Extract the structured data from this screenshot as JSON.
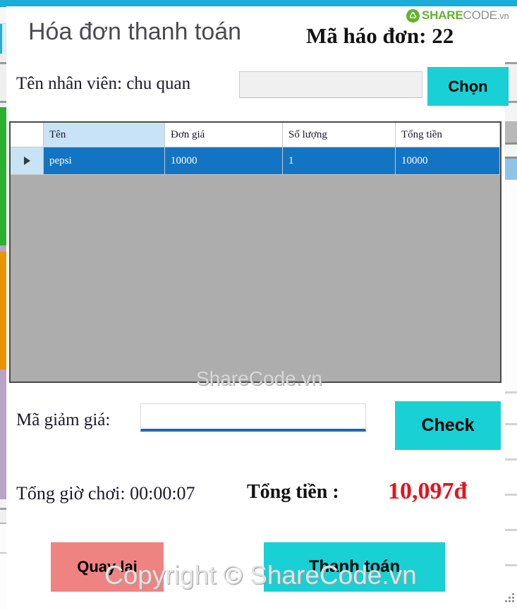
{
  "window": {
    "title_bar_color": "#1badd8",
    "accent_cyan": "#19d0d4",
    "accent_red": "#ef8382",
    "total_color": "#e8121b",
    "grid_empty_color": "#adadad",
    "grid_row_color": "#1474c4"
  },
  "logo": {
    "mark": "recycle-icon",
    "share": "SHARE",
    "code": "CODE",
    "vn": ".vn"
  },
  "header": {
    "title": "Hóa đơn thanh toán",
    "invoice_code": "Mã háo đơn: 22"
  },
  "employee": {
    "label": "Tên nhân viên: chu quan",
    "input_value": "",
    "input_placeholder": "",
    "choose_label": "Chọn"
  },
  "grid": {
    "columns": [
      "",
      "Tên",
      "Đơn giá",
      "Số lượng",
      "Tổng tiền"
    ],
    "selected_column": "Tên",
    "rows": [
      {
        "marker": "row-selector-arrow",
        "ten": "pepsi",
        "don_gia": "10000",
        "so_luong": "1",
        "tong_tien": "10000"
      }
    ]
  },
  "discount": {
    "label": "Mã giảm giá:",
    "input_value": "",
    "input_placeholder": "",
    "check_label": "Check"
  },
  "totals": {
    "play_time_label": "Tổng giờ chơi: 00:00:07",
    "grand_total_label": "Tổng tiền :",
    "grand_total_value": "10,097đ"
  },
  "actions": {
    "back_label": "Quay lai",
    "pay_label": "Thanh toán"
  },
  "watermarks": {
    "grid": "ShareCode.vn",
    "copyright": "Copyright © ShareCode.vn"
  }
}
